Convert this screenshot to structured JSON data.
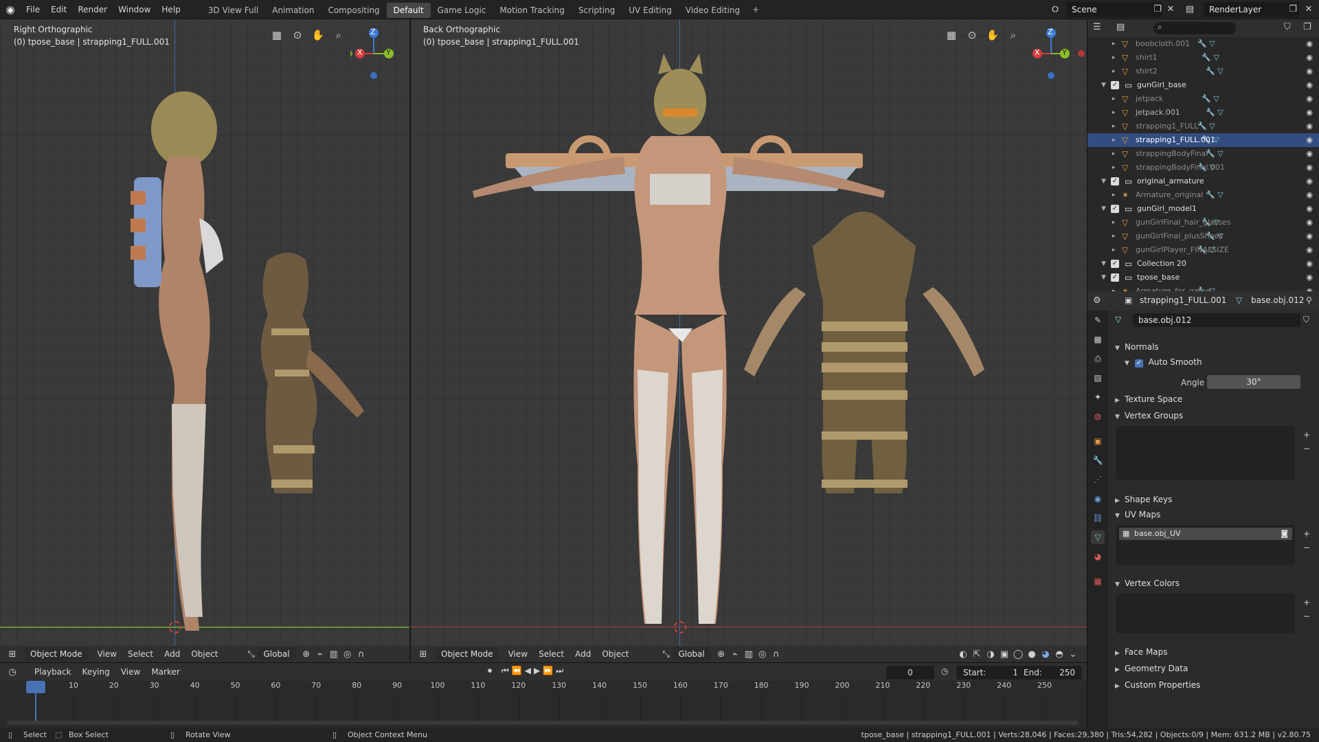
{
  "topbar": {
    "menus": [
      "File",
      "Edit",
      "Render",
      "Window",
      "Help"
    ],
    "workspaces": [
      "3D View Full",
      "Animation",
      "Compositing",
      "Default",
      "Game Logic",
      "Motion Tracking",
      "Scripting",
      "UV Editing",
      "Video Editing"
    ],
    "active_workspace": "Default",
    "add_tab": "+",
    "scene": "Scene",
    "render_layer": "RenderLayer"
  },
  "viewport_left": {
    "view_name": "Right Orthographic",
    "object_info": "(0) tpose_base | strapping1_FULL.001",
    "mode": "Object Mode",
    "menus": [
      "View",
      "Select",
      "Add",
      "Object"
    ],
    "transform": "Global"
  },
  "viewport_right": {
    "view_name": "Back Orthographic",
    "object_info": "(0) tpose_base | strapping1_FULL.001",
    "mode": "Object Mode",
    "menus": [
      "View",
      "Select",
      "Add",
      "Object"
    ],
    "transform": "Global"
  },
  "gizmo": {
    "z": "Z",
    "x": "X",
    "y": "Y"
  },
  "outliner": {
    "rows": [
      {
        "label": "boobcloth.001",
        "indent": 3,
        "type": "object"
      },
      {
        "label": "shirt1",
        "indent": 3,
        "type": "object"
      },
      {
        "label": "shirt2",
        "indent": 3,
        "type": "object"
      },
      {
        "label": "gunGirl_base",
        "indent": 1,
        "type": "collection"
      },
      {
        "label": "jetpack",
        "indent": 3,
        "type": "object"
      },
      {
        "label": "jetpack.001",
        "indent": 3,
        "type": "object"
      },
      {
        "label": "strapping1_FULL",
        "indent": 3,
        "type": "object"
      },
      {
        "label": "strapping1_FULL.001",
        "indent": 3,
        "type": "object",
        "selected": true
      },
      {
        "label": "strappingBodyFinal",
        "indent": 3,
        "type": "object"
      },
      {
        "label": "strappingBodyFinal.001",
        "indent": 3,
        "type": "object"
      },
      {
        "label": "original_armature",
        "indent": 1,
        "type": "collection"
      },
      {
        "label": "Armature_original",
        "indent": 3,
        "type": "armature"
      },
      {
        "label": "gunGirl_model1",
        "indent": 1,
        "type": "collection"
      },
      {
        "label": "gunGirlFinal_hair_glasses",
        "indent": 3,
        "type": "object"
      },
      {
        "label": "gunGirlFinal_plusShoes",
        "indent": 3,
        "type": "object"
      },
      {
        "label": "gunGirlPlayer_FINALSIZE",
        "indent": 3,
        "type": "object"
      },
      {
        "label": "Collection 20",
        "indent": 1,
        "type": "collection"
      },
      {
        "label": "tpose_base",
        "indent": 1,
        "type": "collection"
      },
      {
        "label": "Armature_for_game",
        "indent": 3,
        "type": "armature"
      }
    ]
  },
  "properties": {
    "object_name": "strapping1_FULL.001",
    "data_name": "base.obj.012",
    "mesh_field": "base.obj.012",
    "normals": "Normals",
    "auto_smooth": "Auto Smooth",
    "angle_label": "Angle",
    "angle_value": "30°",
    "texture_space": "Texture Space",
    "vertex_groups": "Vertex Groups",
    "shape_keys": "Shape Keys",
    "uv_maps": "UV Maps",
    "uv_map_item": "base.obj_UV",
    "vertex_colors": "Vertex Colors",
    "face_maps": "Face Maps",
    "geometry_data": "Geometry Data",
    "custom_properties": "Custom Properties"
  },
  "timeline": {
    "menus": [
      "Playback",
      "Keying",
      "View",
      "Marker"
    ],
    "current_frame": "0",
    "start_label": "Start:",
    "start_value": "1",
    "end_label": "End:",
    "end_value": "250",
    "ticks": [
      "0",
      "10",
      "20",
      "30",
      "40",
      "50",
      "60",
      "70",
      "80",
      "90",
      "100",
      "110",
      "120",
      "130",
      "140",
      "150",
      "160",
      "170",
      "180",
      "190",
      "200",
      "210",
      "220",
      "230",
      "240",
      "250"
    ]
  },
  "status": {
    "select": "Select",
    "box_select": "Box Select",
    "rotate_view": "Rotate View",
    "context_menu": "Object Context Menu",
    "stats": "tpose_base | strapping1_FULL.001 | Verts:28,046 | Faces:29,380 | Tris:54,282 | Objects:0/9 | Mem: 631.2 MB | v2.80.75"
  }
}
